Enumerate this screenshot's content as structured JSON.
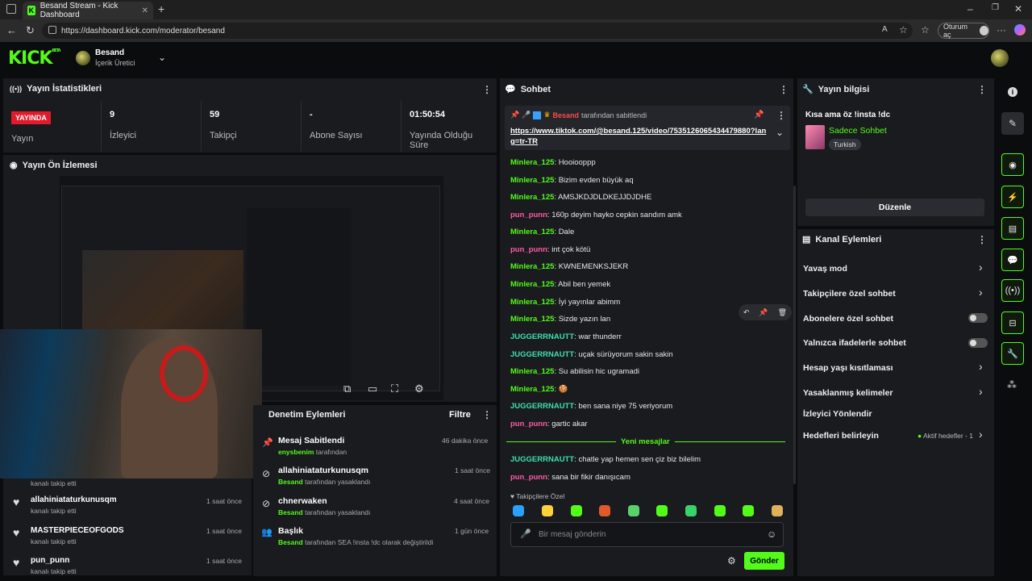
{
  "browser": {
    "tab_title": "Besand Stream - Kick Dashboard",
    "url": "https://dashboard.kick.com/moderator/besand",
    "signin": "Oturum aç"
  },
  "header": {
    "logo": "KICK",
    "logo_badge": "BETA",
    "channel_name": "Besand",
    "channel_role": "İçerik Üretici"
  },
  "stats": {
    "title": "Yayın İstatistikleri",
    "live_badge": "YAYINDA",
    "cells": [
      {
        "value": "",
        "label": "Yayın"
      },
      {
        "value": "9",
        "label": "İzleyici"
      },
      {
        "value": "59",
        "label": "Takipçi"
      },
      {
        "value": "-",
        "label": "Abone Sayısı"
      },
      {
        "value": "01:50:54",
        "label": "Yayında Olduğu Süre"
      }
    ]
  },
  "preview": {
    "title": "Yayın Ön İzlemesi"
  },
  "follows": [
    {
      "name": "",
      "sub": "kanalı takip etti",
      "time": ""
    },
    {
      "name": "allahiniataturkunusqm",
      "sub": "kanalı takip etti",
      "time": "1 saat önce"
    },
    {
      "name": "MASTERPIECEOFGODS",
      "sub": "kanalı takip etti",
      "time": "1 saat önce"
    },
    {
      "name": "pun_punn",
      "sub": "kanalı takip etti",
      "time": "1 saat önce"
    }
  ],
  "moderation": {
    "title": "Denetim Eylemleri",
    "filter": "Filtre",
    "items": [
      {
        "title": "Mesaj Sabitlendi",
        "actor": "enysbenim",
        "desc": "tarafından",
        "time": "46 dakika önce"
      },
      {
        "title": "allahiniataturkunusqm",
        "actor": "Besand",
        "desc": "tarafından yasaklandı",
        "time": "1 saat önce"
      },
      {
        "title": "chnerwaken",
        "actor": "Besand",
        "desc": "tarafından yasaklandı",
        "time": "4 saat önce"
      },
      {
        "title": "Başlık",
        "actor": "Besand",
        "desc": "tarafından SEA !insta !dc olarak değiştirildi",
        "time": "1 gün önce"
      }
    ]
  },
  "chat": {
    "title": "Sohbet",
    "pinned_by": "Besand",
    "pinned_suffix": "tarafından sabitlendi",
    "pinned_link": "https://www.tiktok.com/@besand.125/video/7535126065434479880?lang=tr-TR",
    "messages": [
      {
        "user": "Minlera_125",
        "color": "g",
        "text": "Hooiooppp"
      },
      {
        "user": "Minlera_125",
        "color": "g",
        "text": "Bizim evden büyük aq"
      },
      {
        "user": "Minlera_125",
        "color": "g",
        "text": "AMSJKDJDLDKEJJDJDHE"
      },
      {
        "user": "pun_punn",
        "color": "p",
        "text": "160p deyim hayko cepkin sandım amk"
      },
      {
        "user": "Minlera_125",
        "color": "g",
        "text": "Dale"
      },
      {
        "user": "pun_punn",
        "color": "p",
        "text": "int çok kötü"
      },
      {
        "user": "Minlera_125",
        "color": "g",
        "text": "KWNEMENKSJEKR"
      },
      {
        "user": "Minlera_125",
        "color": "g",
        "text": "Abil ben yemek"
      },
      {
        "user": "Minlera_125",
        "color": "g",
        "text": "İyi yayınlar abimm"
      },
      {
        "user": "Minlera_125",
        "color": "g",
        "text": "Sizde yazın lan"
      },
      {
        "user": "JUGGERRNAUTT",
        "color": "t",
        "text": "war thunderr"
      },
      {
        "user": "JUGGERRNAUTT",
        "color": "t",
        "text": "uçak sürüyorum sakin sakin"
      },
      {
        "user": "Minlera_125",
        "color": "g",
        "text": "Su abilisin hic ugramadi"
      },
      {
        "user": "Minlera_125",
        "color": "g",
        "text": "🍪"
      },
      {
        "user": "JUGGERRNAUTT",
        "color": "t",
        "text": "ben sana niye 75 veriyorum"
      },
      {
        "user": "pun_punn",
        "color": "p",
        "text": "gartic akar"
      }
    ],
    "new_messages": "Yeni mesajlar",
    "new": [
      {
        "user": "JUGGERRNAUTT",
        "color": "t",
        "text": "chatle yap hemen sen çiz biz bilelim"
      },
      {
        "user": "pun_punn",
        "color": "p",
        "text": "sana bir fikir danışıcam"
      }
    ],
    "follower_only": "Takipçilere Özel",
    "placeholder": "Bir mesaj gönderin",
    "send": "Gönder"
  },
  "stream_info": {
    "title": "Yayın bilgisi",
    "stream_title": "Kısa ama öz !insta !dc",
    "category": "Sadece Sohbet",
    "tag": "Turkish",
    "edit": "Düzenle"
  },
  "channel_actions": {
    "title": "Kanal Eylemleri",
    "rows": [
      {
        "label": "Yavaş mod",
        "kind": "chevron"
      },
      {
        "label": "Takipçilere özel sohbet",
        "kind": "chevron"
      },
      {
        "label": "Abonelere özel sohbet",
        "kind": "toggle"
      },
      {
        "label": "Yalnızca ifadelerle sohbet",
        "kind": "toggle"
      },
      {
        "label": "Hesap yaşı kısıtlaması",
        "kind": "chevron"
      },
      {
        "label": "Yasaklanmış kelimeler",
        "kind": "chevron"
      },
      {
        "label": "İzleyici Yönlendir",
        "kind": "none"
      },
      {
        "label": "Hedefleri belirleyin",
        "kind": "chevron",
        "extra": "Aktif hedefler - 1"
      }
    ]
  },
  "colors": {
    "accent": "#53fc18",
    "live": "#e11a2c",
    "panel": "#191b1f"
  }
}
